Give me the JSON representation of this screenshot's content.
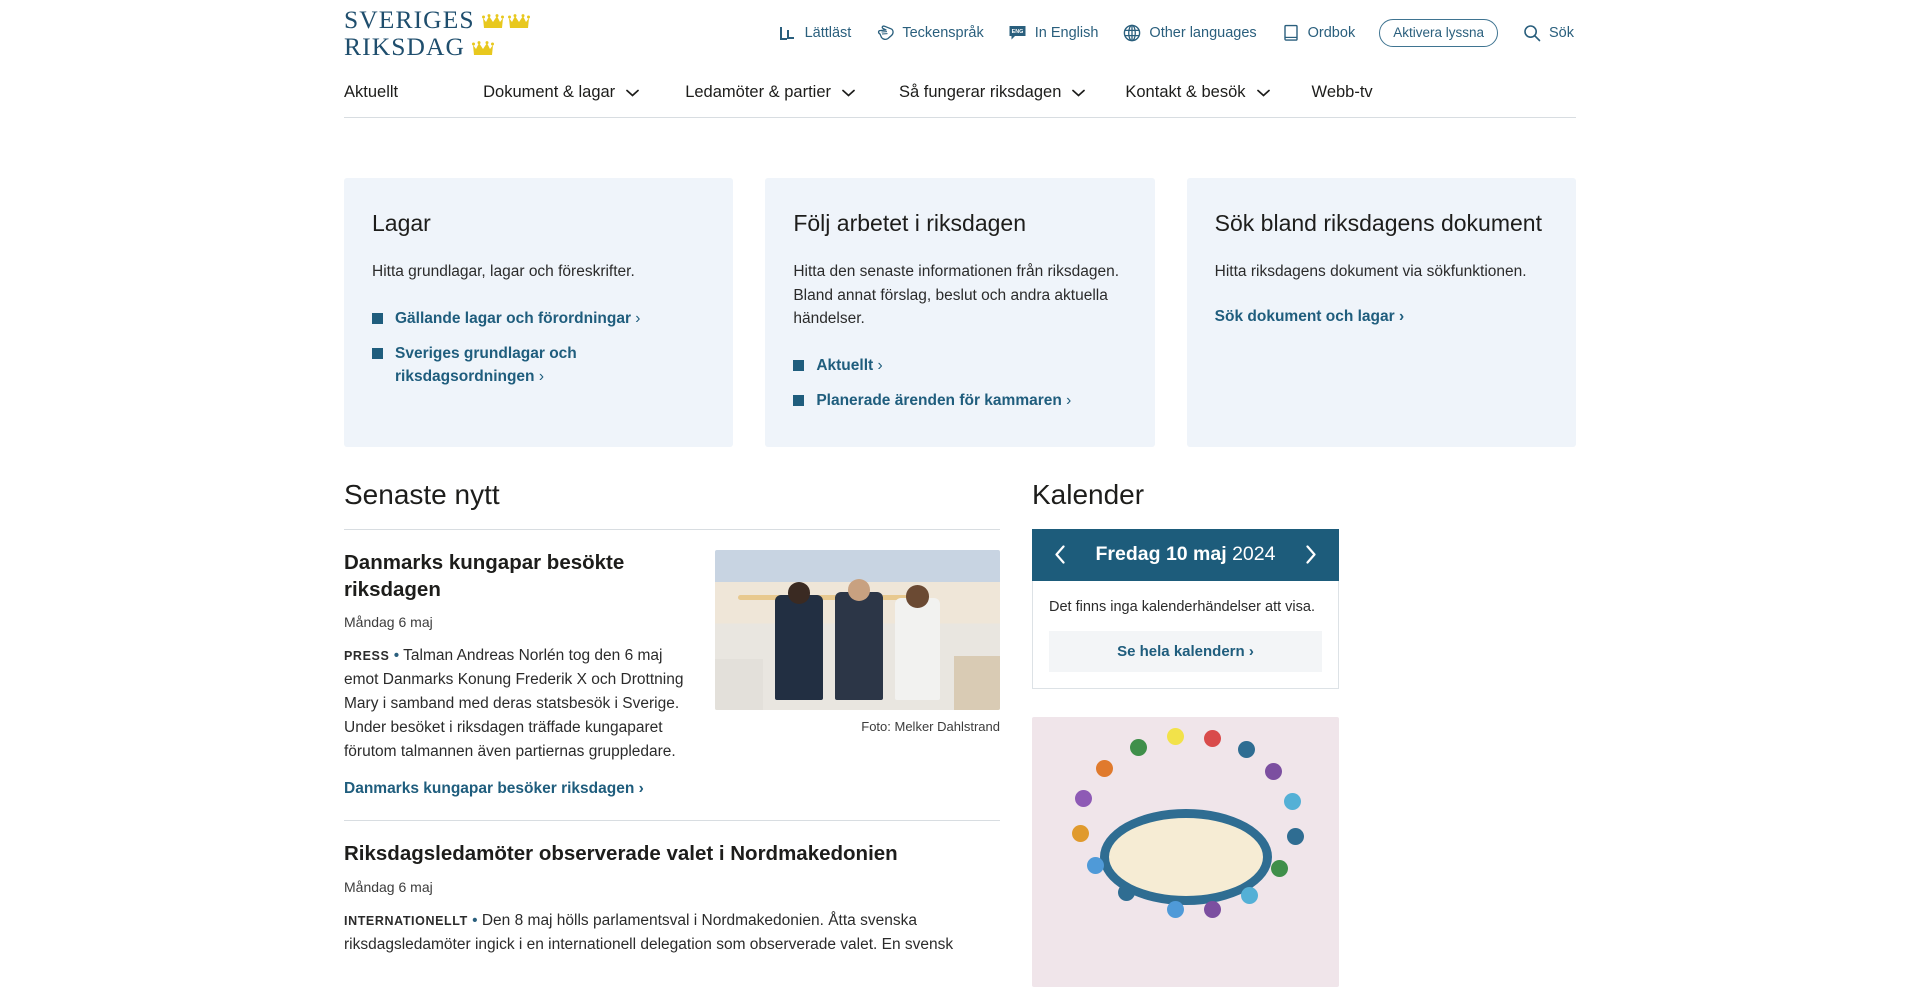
{
  "site": {
    "logo_line1": "SVERIGES",
    "logo_line2": "RIKSDAG",
    "crown_color": "#e8c81e",
    "logo_color": "#1f4e6d",
    "accent_link": "#1f5d7d",
    "calendar_header_bg": "#1d5c7b",
    "card_bg": "#eff4fa"
  },
  "utility_nav": [
    {
      "label": "Lättläst",
      "icon": "easy-read-icon"
    },
    {
      "label": "Teckenspråk",
      "icon": "sign-language-hand-icon"
    },
    {
      "label": "In English",
      "icon": "english-speech-bubble-icon"
    },
    {
      "label": "Other languages",
      "icon": "globe-icon"
    },
    {
      "label": "Ordbok",
      "icon": "book-icon"
    }
  ],
  "listen_button": "Aktivera lyssna",
  "search": {
    "label": "Sök",
    "icon": "search-icon"
  },
  "main_nav": [
    {
      "label": "Aktuellt",
      "has_dropdown": false
    },
    {
      "label": "Dokument & lagar",
      "has_dropdown": true
    },
    {
      "label": "Ledamöter & partier",
      "has_dropdown": true
    },
    {
      "label": "Så fungerar riksdagen",
      "has_dropdown": true
    },
    {
      "label": "Kontakt & besök",
      "has_dropdown": true
    },
    {
      "label": "Webb-tv",
      "has_dropdown": false
    }
  ],
  "cards": [
    {
      "title": "Lagar",
      "text": "Hitta grundlagar, lagar och föreskrifter.",
      "links": [
        {
          "label": "Gällande lagar och förordningar",
          "bullet": true
        },
        {
          "label": "Sveriges grundlagar och riksdagsordningen",
          "bullet": true
        }
      ]
    },
    {
      "title": "Följ arbetet i riksdagen",
      "text": "Hitta den senaste informationen från riksdagen. Bland annat förslag, beslut och andra aktuella händelser.",
      "links": [
        {
          "label": "Aktuellt",
          "bullet": true
        },
        {
          "label": "Planerade ärenden för kammaren",
          "bullet": true
        }
      ]
    },
    {
      "title": "Sök bland riksdagens dokument",
      "text": "Hitta riksdagens dokument via sökfunktionen.",
      "links": [
        {
          "label": "Sök dokument och lagar",
          "bullet": false
        }
      ]
    }
  ],
  "news": {
    "heading": "Senaste nytt",
    "articles": [
      {
        "title": "Danmarks kungapar besökte riksdagen",
        "date": "Måndag 6 maj",
        "tag": "PRESS",
        "body": "Talman Andreas Norlén tog den 6 maj emot Danmarks Konung Frederik X och Drottning Mary i samband med deras statsbesök i Sverige. Under besöket i riksdagen träffade kungaparet förutom talmannen även partiernas gruppledare.",
        "link": "Danmarks kungapar besöker riksdagen",
        "photo_caption": "Foto: Melker Dahlstrand",
        "has_photo": true
      },
      {
        "title": "Riksdagsledamöter observerade valet i Nordmakedonien",
        "date": "Måndag 6 maj",
        "tag": "INTERNATIONELLT",
        "body": "Den 8 maj hölls parlamentsval i Nordmakedonien. Åtta svenska riksdagsledamöter ingick i en internationell delegation som observerade valet. En svensk",
        "link": "",
        "photo_caption": "",
        "has_photo": false
      }
    ]
  },
  "calendar": {
    "heading": "Kalender",
    "prev_icon": "chevron-left-icon",
    "next_icon": "chevron-right-icon",
    "day_label": "Fredag 10 maj",
    "year": "2024",
    "empty_text": "Det finns inga kalenderhändelser att visa.",
    "all_link": "Se hela kalendern"
  },
  "promo": {
    "alt": "illustration-round-table-meeting"
  }
}
